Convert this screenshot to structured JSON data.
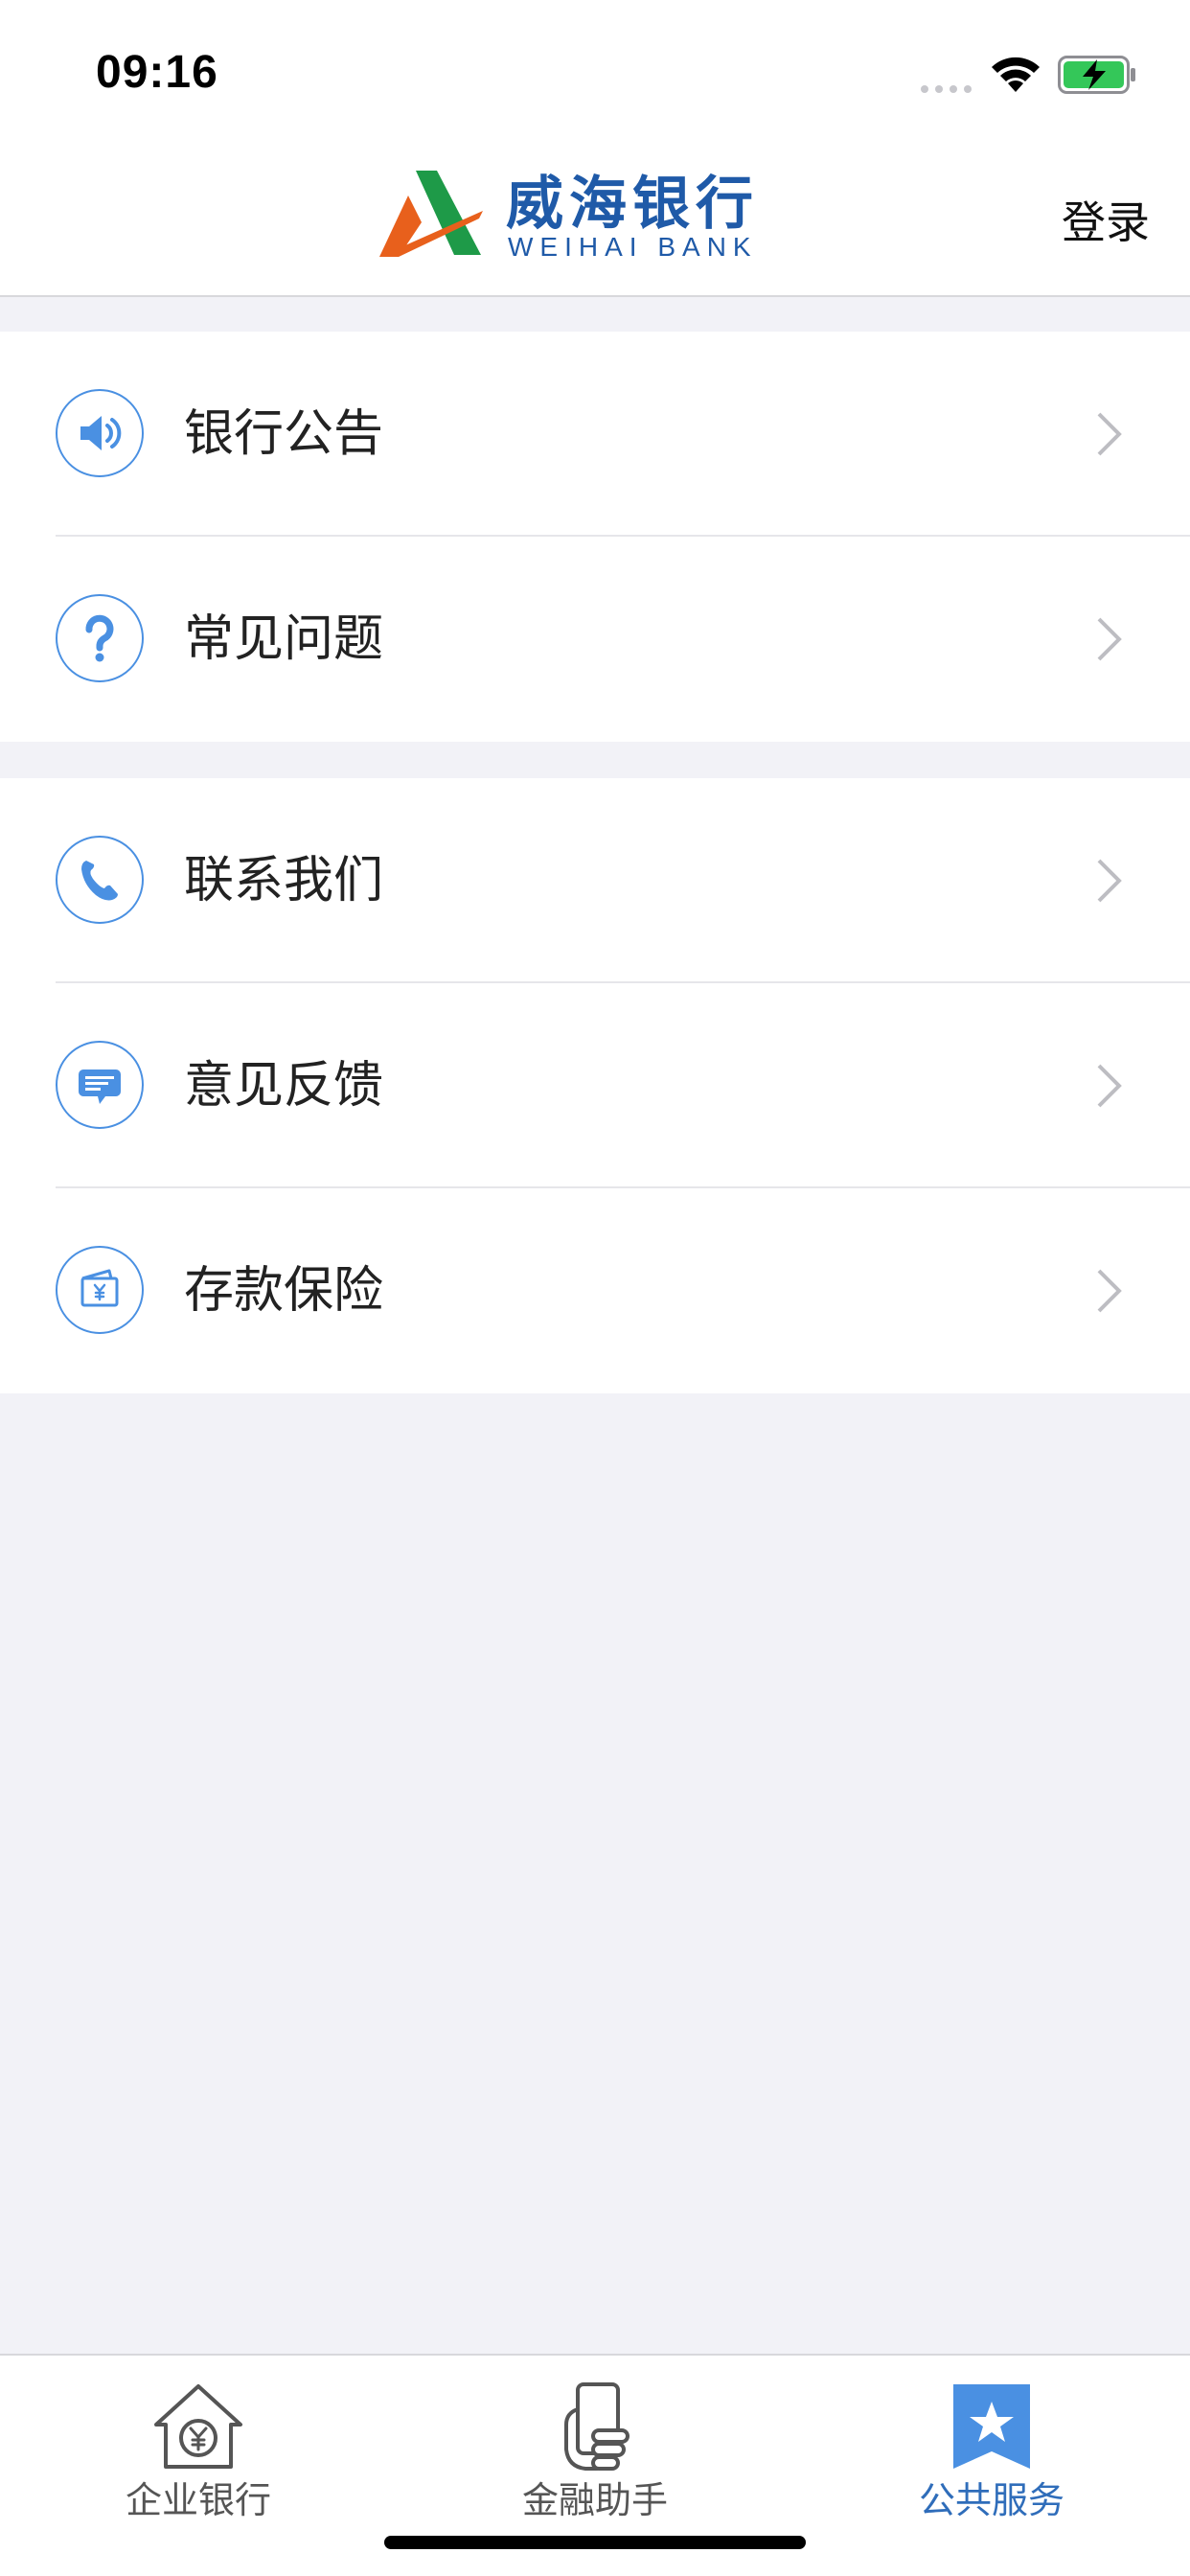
{
  "status_bar": {
    "time": "09:16"
  },
  "header": {
    "logo_text": "威海银行",
    "logo_subtext": "WEIHAI BANK",
    "login_label": "登录"
  },
  "menu": {
    "group1": [
      {
        "label": "银行公告",
        "icon": "speaker-icon"
      },
      {
        "label": "常见问题",
        "icon": "question-icon"
      }
    ],
    "group2": [
      {
        "label": "联系我们",
        "icon": "phone-icon"
      },
      {
        "label": "意见反馈",
        "icon": "feedback-chat-icon"
      },
      {
        "label": "存款保险",
        "icon": "deposit-insurance-icon"
      }
    ]
  },
  "tab_bar": {
    "tabs": [
      {
        "label": "企业银行",
        "icon": "house-yuan-icon",
        "active": false
      },
      {
        "label": "金融助手",
        "icon": "phone-hand-icon",
        "active": false
      },
      {
        "label": "公共服务",
        "icon": "star-bookmark-icon",
        "active": true
      }
    ]
  },
  "colors": {
    "accent": "#4A90E2",
    "brand_blue": "#1F5AA8",
    "logo_orange": "#E8601C",
    "logo_green": "#1E9A48",
    "background": "#F2F2F7"
  }
}
